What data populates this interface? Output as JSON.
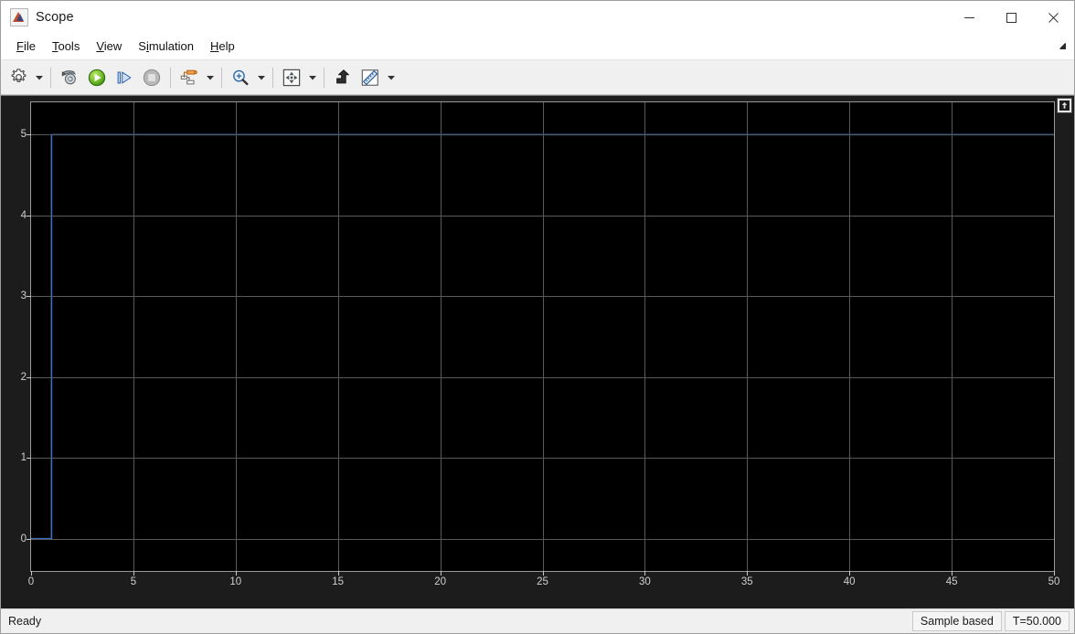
{
  "window": {
    "title": "Scope",
    "app_icon": "matlab-icon",
    "controls": [
      {
        "name": "minimize-button",
        "glyph": "minimize-icon"
      },
      {
        "name": "maximize-button",
        "glyph": "maximize-icon"
      },
      {
        "name": "close-button",
        "glyph": "close-icon"
      }
    ]
  },
  "menubar": {
    "items": [
      {
        "name": "menu-file",
        "label": "File",
        "mnemonic": "F"
      },
      {
        "name": "menu-tools",
        "label": "Tools",
        "mnemonic": "T"
      },
      {
        "name": "menu-view",
        "label": "View",
        "mnemonic": "V"
      },
      {
        "name": "menu-simulation",
        "label": "Simulation",
        "mnemonic": "S"
      },
      {
        "name": "menu-help",
        "label": "Help",
        "mnemonic": "H"
      }
    ],
    "dock_arrow_icon": "undock-arrow-icon"
  },
  "toolbar": {
    "buttons": [
      {
        "name": "configuration-properties-button",
        "icon": "gear-icon",
        "has_dropdown": true,
        "enabled": true
      },
      {
        "name": "run-back-to-start-button",
        "icon": "rewind-run-icon",
        "has_dropdown": false,
        "enabled": true
      },
      {
        "name": "run-button",
        "icon": "play-icon",
        "has_dropdown": false,
        "enabled": true
      },
      {
        "name": "step-forward-button",
        "icon": "step-forward-icon",
        "has_dropdown": false,
        "enabled": true
      },
      {
        "name": "stop-button",
        "icon": "stop-icon",
        "has_dropdown": false,
        "enabled": false
      },
      {
        "name": "signal-selection-button",
        "icon": "signal-blocks-icon",
        "has_dropdown": true,
        "enabled": true
      },
      {
        "name": "zoom-in-button",
        "icon": "zoom-in-magnifier-icon",
        "has_dropdown": true,
        "enabled": true
      },
      {
        "name": "autoscale-button",
        "icon": "autoscale-arrows-icon",
        "has_dropdown": true,
        "enabled": true
      },
      {
        "name": "style-button",
        "icon": "style-arrow-icon",
        "has_dropdown": false,
        "enabled": true
      },
      {
        "name": "measurements-button",
        "icon": "ruler-icon",
        "has_dropdown": true,
        "enabled": true
      }
    ]
  },
  "plot": {
    "expand_button_icon": "expand-axes-icon",
    "background_color": "#000000",
    "grid_color": "#5a5a5a",
    "axis_label_color": "#d0d0d0",
    "trace_color": "#3c6fc4"
  },
  "statusbar": {
    "ready_text": "Ready",
    "sample_mode": "Sample based",
    "time": "T=50.000"
  },
  "chart_data": {
    "type": "line",
    "title": "",
    "xlabel": "",
    "ylabel": "",
    "xlim": [
      0,
      50
    ],
    "ylim": [
      -0.4,
      5.4
    ],
    "xticks": [
      0,
      5,
      10,
      15,
      20,
      25,
      30,
      35,
      40,
      45,
      50
    ],
    "xtick_labels": [
      "0",
      "5",
      "10",
      "15",
      "20",
      "25",
      "30",
      "35",
      "40",
      "45",
      "50"
    ],
    "yticks": [
      0,
      1,
      2,
      3,
      4,
      5
    ],
    "ytick_labels": [
      "0",
      "1",
      "2",
      "3",
      "4",
      "5"
    ],
    "grid": true,
    "legend": "none",
    "series": [
      {
        "name": "signal-1",
        "color": "#3c6fc4",
        "description": "Step response rising from 0 to 5 at t = 1",
        "x": [
          0,
          1,
          1,
          50
        ],
        "y": [
          0,
          0,
          5,
          5
        ]
      }
    ]
  }
}
